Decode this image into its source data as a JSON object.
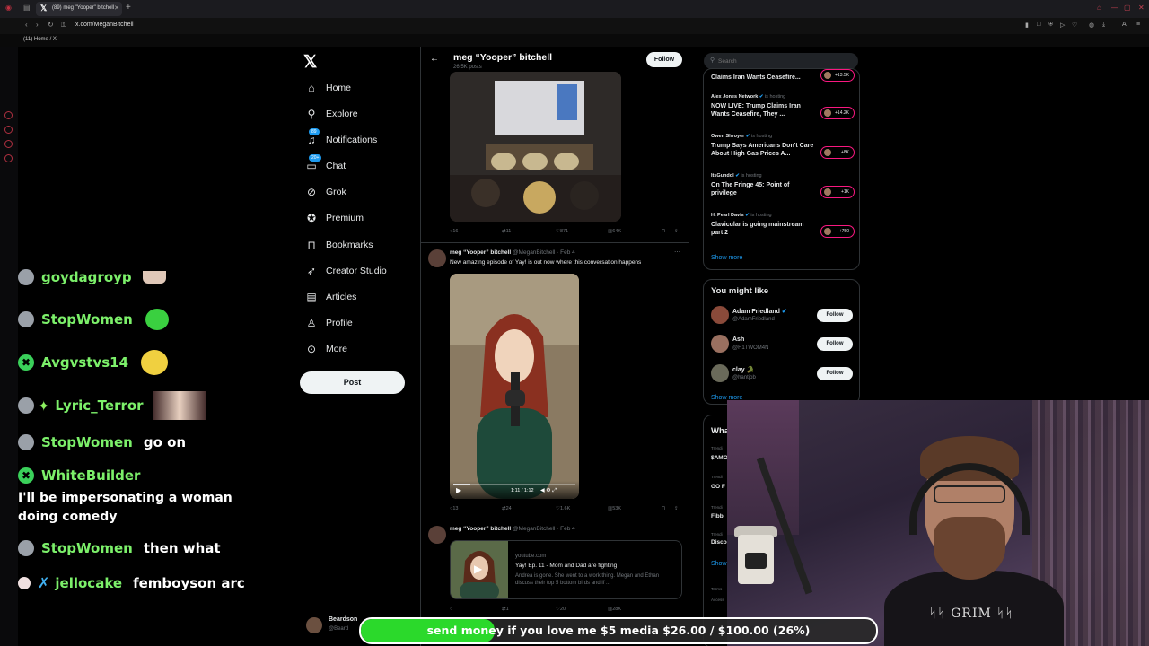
{
  "browser": {
    "tab_title": "(89) meg \"Yooper\" bitchell",
    "url": "x.com/MeganBitchell",
    "bookmark": "(11) Home / X",
    "ext_ai": "AI"
  },
  "nav": {
    "items": [
      {
        "label": "Home",
        "icon": "home-icon"
      },
      {
        "label": "Explore",
        "icon": "search-icon"
      },
      {
        "label": "Notifications",
        "icon": "bell-icon",
        "badge": "89"
      },
      {
        "label": "Chat",
        "icon": "chat-icon",
        "badge": "20+"
      },
      {
        "label": "Grok",
        "icon": "grok-icon"
      },
      {
        "label": "Premium",
        "icon": "premium-icon"
      },
      {
        "label": "Bookmarks",
        "icon": "bookmark-icon"
      },
      {
        "label": "Creator Studio",
        "icon": "rocket-icon"
      },
      {
        "label": "Articles",
        "icon": "article-icon"
      },
      {
        "label": "Profile",
        "icon": "profile-icon"
      },
      {
        "label": "More",
        "icon": "more-icon"
      }
    ],
    "post_label": "Post",
    "account_name": "Beardson",
    "account_handle": "@Beard"
  },
  "profile": {
    "name": "meg “Yooper” bitchell",
    "posts": "26.5K posts",
    "follow_label": "Follow"
  },
  "tweets": [
    {
      "stats": {
        "replies": "16",
        "retweets": "11",
        "likes": "871",
        "views": "64K"
      }
    },
    {
      "author": "meg “Yooper” bitchell",
      "handle": "@MeganBitchell · Feb 4",
      "text": "New amazing episode of Yay! is out now where this conversation happens",
      "video_time": "1:11 / 1:12",
      "stats": {
        "replies": "13",
        "retweets": "24",
        "likes": "1.6K",
        "views": "53K"
      }
    },
    {
      "author": "meg “Yooper” bitchell",
      "handle": "@MeganBitchell · Feb 4",
      "card_domain": "youtube.com",
      "card_title": "Yay! Ep. 11 - Mom and Dad are fighting",
      "card_desc": "Andrea is gone. She went to a work thing. Megan and Ethan discuss their top 5 bottom birds and if ...",
      "stats": {
        "replies": "",
        "retweets": "1",
        "likes": "20",
        "views": "28K"
      }
    }
  ],
  "sidebar": {
    "search_placeholder": "Search",
    "spaces": [
      {
        "host": "",
        "hosting": "",
        "title": "Claims Iran Wants Ceasefire...",
        "count": "+13.5K"
      },
      {
        "host": "Alex Jones Network",
        "hosting": "is hosting",
        "title": "NOW LIVE: Trump Claims Iran Wants Ceasefire, They ...",
        "count": "+14.2K"
      },
      {
        "host": "Owen Shroyer",
        "hosting": "is hosting",
        "title": "Trump Says Americans Don't Care About High Gas Prices A...",
        "count": "+8K"
      },
      {
        "host": "ItsGundol",
        "hosting": "is hosting",
        "title": "On The Fringe 45: Point of privilege",
        "count": "+1K"
      },
      {
        "host": "H. Pearl Davis",
        "hosting": "is hosting",
        "title": "Clavicular is going mainstream part 2",
        "count": "+750"
      }
    ],
    "show_more": "Show more",
    "you_might_like_title": "You might like",
    "suggestions": [
      {
        "name": "Adam Friedland",
        "handle": "@AdamFriedland",
        "color": "#8a4a3a"
      },
      {
        "name": "Ash",
        "handle": "@H1TWOM4N",
        "color": "#9a7060"
      },
      {
        "name": "clay 🐊",
        "handle": "@hantjob",
        "color": "#6a6a5a"
      }
    ],
    "follow_label": "Follow",
    "show_more_2": "Show more",
    "trends_title": "Wha",
    "trends": [
      {
        "meta": "Trendi",
        "name": "$AMO"
      },
      {
        "meta": "Trendi",
        "name": "GO F"
      },
      {
        "meta": "Trendi",
        "name": "Fibb"
      },
      {
        "meta": "Trendi",
        "name": "Disco"
      },
      {
        "meta": "",
        "name": "Show"
      }
    ],
    "footer_1": "Terms",
    "footer_2": "Access"
  },
  "chat": {
    "messages": [
      {
        "user": "goydagroyp",
        "text": ""
      },
      {
        "user": "StopWomen",
        "text": ""
      },
      {
        "user": "Avgvstvs14",
        "text": ""
      },
      {
        "user": "Lyric_Terror",
        "text": ""
      },
      {
        "user": "StopWomen",
        "text": "go on"
      },
      {
        "user": "WhiteBuilder",
        "text": ""
      },
      {
        "user": "StopWomen",
        "text": "then what"
      },
      {
        "user": "jellocake",
        "text": "femboyson arc"
      }
    ],
    "multiline_1": "I'll be impersonating a woman",
    "multiline_2": "doing comedy"
  },
  "donation": {
    "text": "send money if you love me $5 media $26.00 / $100.00 (26%)",
    "progress": 0.26
  },
  "webcam": {
    "shirt_text": "ᛋᛋ GRIM ᛋᛋ"
  },
  "colors": {
    "accent": "#1d9bf0",
    "live_ring": "#f91880",
    "chat_green": "#7cf06a",
    "donation_green": "#2bd92b"
  }
}
